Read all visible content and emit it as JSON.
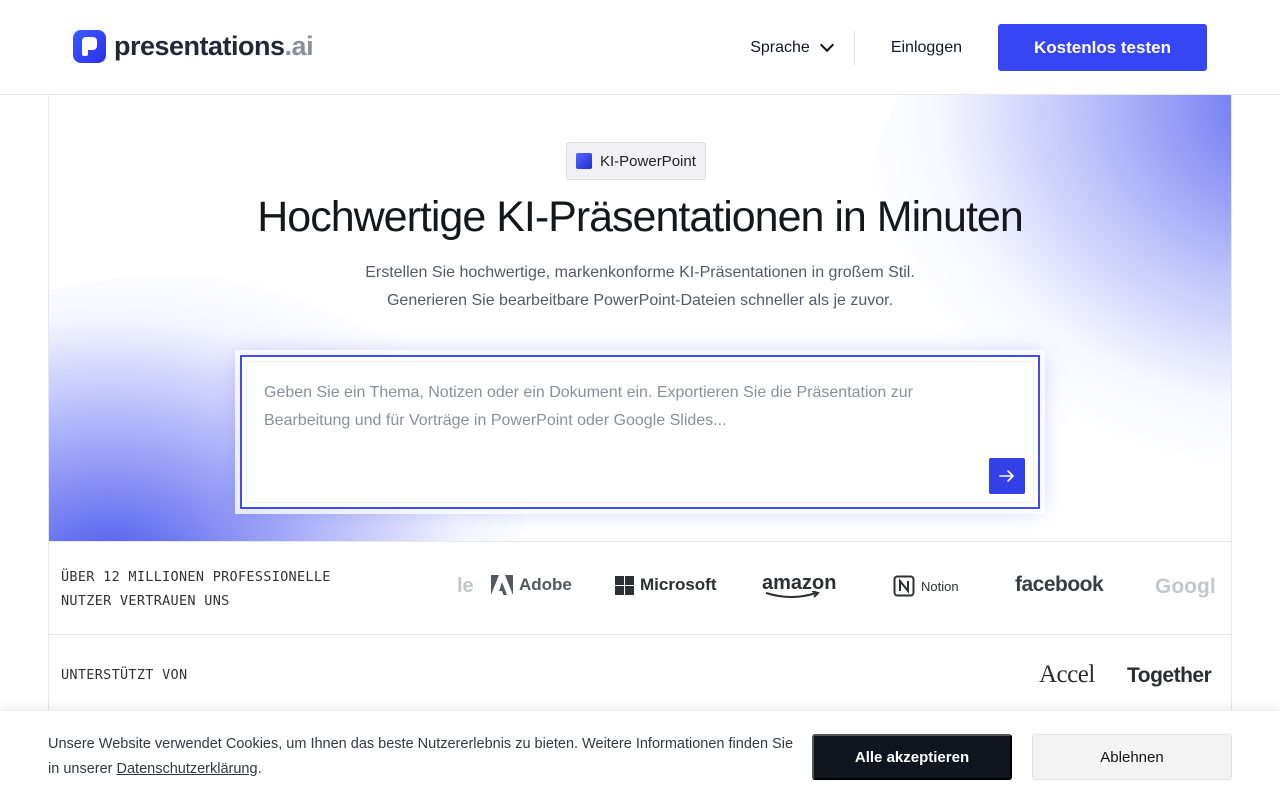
{
  "header": {
    "logo_name": "presentations",
    "logo_tld": ".ai",
    "language_label": "Sprache",
    "login_label": "Einloggen",
    "cta_label": "Kostenlos testen",
    "accent_color": "#3646f5"
  },
  "hero": {
    "badge": "KI-PowerPoint",
    "title": "Hochwertige KI-Präsentationen in Minuten",
    "subtitle_line1": "Erstellen Sie hochwertige, markenkonforme KI-Präsentationen in großem Stil.",
    "subtitle_line2": "Generieren Sie bearbeitbare PowerPoint-Dateien schneller als je zuvor.",
    "prompt_placeholder": "Geben Sie ein Thema, Notizen oder ein Dokument ein. Exportieren Sie die Präsentation zur Bearbeitung und für Vorträge in PowerPoint oder Google Slides..."
  },
  "trust": {
    "text_line1": "ÜBER 12 MILLIONEN PROFESSIONELLE",
    "text_line2": "NUTZER VERTRAUEN UNS",
    "brands": [
      "le",
      "Adobe",
      "Microsoft",
      "amazon",
      "Notion",
      "facebook",
      "Googl"
    ]
  },
  "support": {
    "label": "UNTERSTÜTZT VON",
    "backers": [
      "Accel",
      "Together"
    ]
  },
  "cookie": {
    "text": "Unsere Website verwendet Cookies, um Ihnen das beste Nutzererlebnis zu bieten. Weitere Informationen finden Sie in unserer ",
    "link": "Datenschutzerklärung",
    "text_end": ".",
    "accept_label": "Alle akzeptieren",
    "decline_label": "Ablehnen"
  }
}
